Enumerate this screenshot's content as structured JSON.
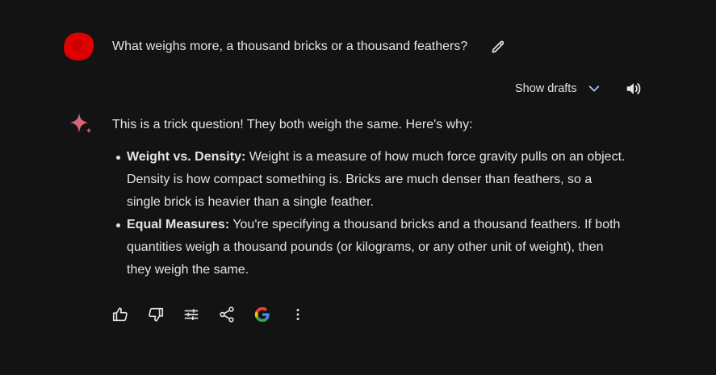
{
  "prompt": {
    "text": "What weighs more, a thousand bricks or a thousand feathers?",
    "avatar_icon": "user-avatar-red-blob",
    "edit_icon": "pencil-icon"
  },
  "header_actions": {
    "show_drafts_label": "Show drafts",
    "drafts_icon": "chevron-down-icon",
    "speaker_icon": "speaker-icon"
  },
  "response": {
    "icon": "gemini-sparkle-icon",
    "intro": "This is a trick question! They both weigh the same. Here's why:",
    "bullets": [
      {
        "title": "Weight vs. Density:",
        "text": " Weight is a measure of how much force gravity pulls on an object. Density is how compact something is. Bricks are much denser than feathers, so a single brick is heavier than a single feather."
      },
      {
        "title": "Equal Measures:",
        "text": " You're specifying a thousand bricks and a thousand feathers. If both quantities weigh a thousand pounds (or kilograms, or any other unit of weight), then they weigh the same."
      }
    ]
  },
  "action_bar": {
    "icons": [
      "thumbs-up-icon",
      "thumbs-down-icon",
      "modify-response-icon",
      "share-icon",
      "google-icon",
      "more-vert-icon"
    ]
  },
  "colors": {
    "background": "#131314",
    "text": "#e3e3e3",
    "avatar_red": "#e00000",
    "sparkle_pink": "#d96570",
    "google_blue": "#4285f4",
    "google_red": "#ea4335",
    "google_yellow": "#fbbc05",
    "google_green": "#34a853"
  }
}
